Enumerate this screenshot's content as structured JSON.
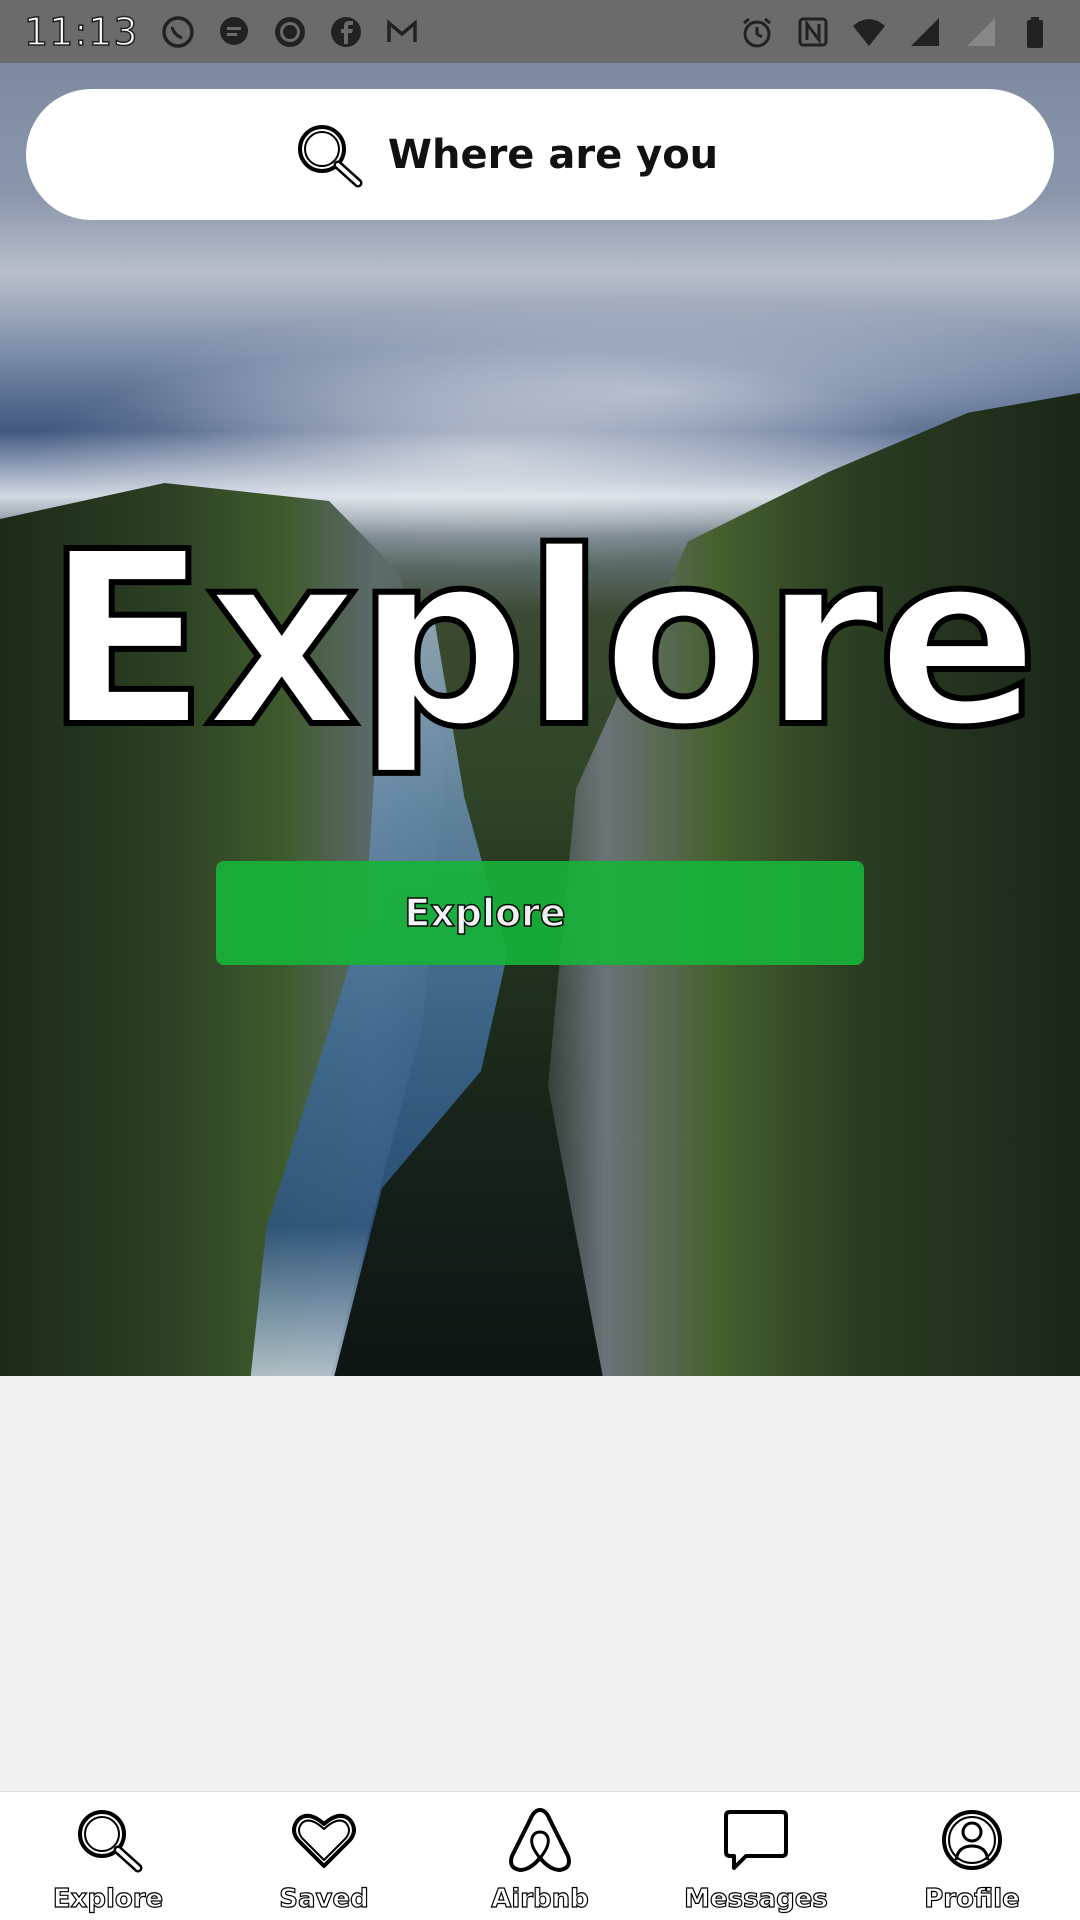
{
  "status_bar": {
    "time": "11:13",
    "left_icons": [
      "whatsapp-icon",
      "chat-icon",
      "ring-icon",
      "facebook-icon",
      "gmail-icon"
    ],
    "right_icons": [
      "alarm-icon",
      "nfc-icon",
      "wifi-icon",
      "signal-icon",
      "signal-roaming-icon",
      "battery-icon"
    ]
  },
  "search": {
    "icon": "search-icon",
    "placeholder": "Where are you"
  },
  "hero": {
    "title": "Explore",
    "button_label": "Explore",
    "button_color": "#18b23a"
  },
  "bottom_nav": {
    "items": [
      {
        "label": "Explore",
        "icon": "search-icon"
      },
      {
        "label": "Saved",
        "icon": "heart-icon"
      },
      {
        "label": "Airbnb",
        "icon": "airbnb-logo-icon"
      },
      {
        "label": "Messages",
        "icon": "message-icon"
      },
      {
        "label": "Profile",
        "icon": "profile-icon"
      }
    ]
  }
}
